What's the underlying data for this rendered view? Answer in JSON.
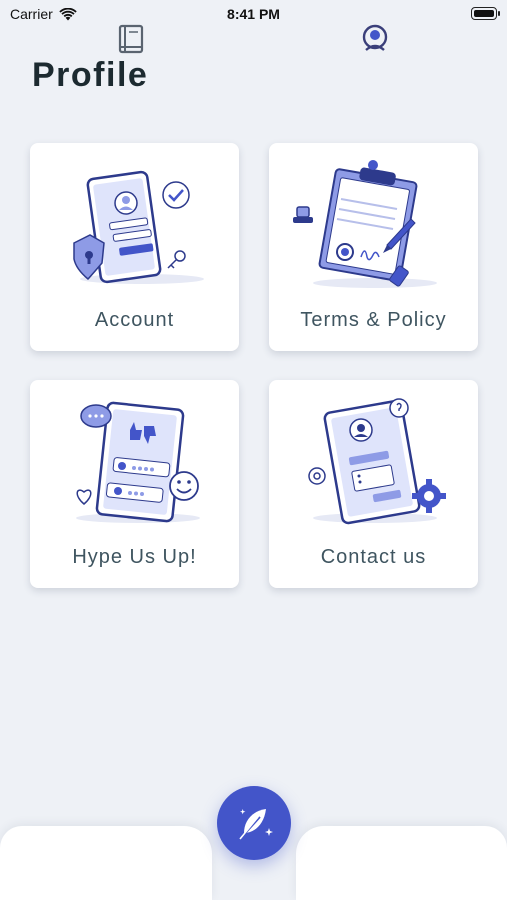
{
  "status_bar": {
    "carrier": "Carrier",
    "time": "8:41 PM"
  },
  "page": {
    "title": "Profile"
  },
  "cards": [
    {
      "label": "Account",
      "icon": "account-illustration-icon"
    },
    {
      "label": "Terms & Policy",
      "icon": "terms-illustration-icon"
    },
    {
      "label": "Hype Us Up!",
      "icon": "hype-illustration-icon"
    },
    {
      "label": "Contact us",
      "icon": "contact-illustration-icon"
    }
  ],
  "bottom_nav": {
    "left_icon": "book-icon",
    "center_icon": "feather-icon",
    "right_icon": "profile-icon"
  },
  "colors": {
    "accent": "#4355c9",
    "background": "#eef1f6",
    "card": "#ffffff",
    "label": "#3f5560"
  }
}
